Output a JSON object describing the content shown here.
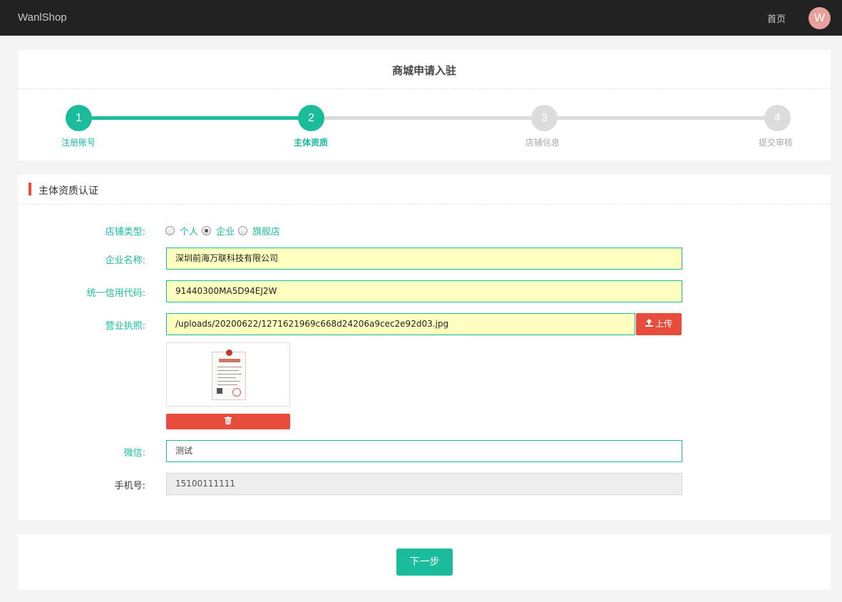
{
  "header": {
    "brand": "WanlShop",
    "home_link": "首页",
    "avatar_letter": "W"
  },
  "page": {
    "title": "商城申请入驻"
  },
  "steps": [
    {
      "number": "1",
      "label": "注册账号",
      "state": "done"
    },
    {
      "number": "2",
      "label": "主体资质",
      "state": "active"
    },
    {
      "number": "3",
      "label": "店铺信息",
      "state": "pending"
    },
    {
      "number": "4",
      "label": "提交审核",
      "state": "pending"
    }
  ],
  "colors": {
    "accent": "#1abc9c",
    "danger": "#e74c3c",
    "header_bg": "#222222",
    "input_fill": "#ffffc0"
  },
  "section": {
    "title": "主体资质认证"
  },
  "form": {
    "shop_type": {
      "label": "店铺类型:",
      "options": [
        "个人",
        "企业",
        "旗舰店"
      ],
      "selected": "企业"
    },
    "company_name": {
      "label": "企业名称:",
      "value": "深圳前海万联科技有限公司"
    },
    "credit_code": {
      "label": "统一信用代码:",
      "value": "91440300MA5D94EJ2W"
    },
    "license": {
      "label": "营业执照:",
      "value": "/uploads/20200622/1271621969c668d24206a9cec2e92d03.jpg",
      "upload_label": "上传",
      "upload_icon": "upload-icon",
      "delete_icon": "trash-icon"
    },
    "wechat": {
      "label": "微信:",
      "value": "测试"
    },
    "phone": {
      "label": "手机号:",
      "value": "15100111111"
    }
  },
  "footer": {
    "next_label": "下一步"
  }
}
